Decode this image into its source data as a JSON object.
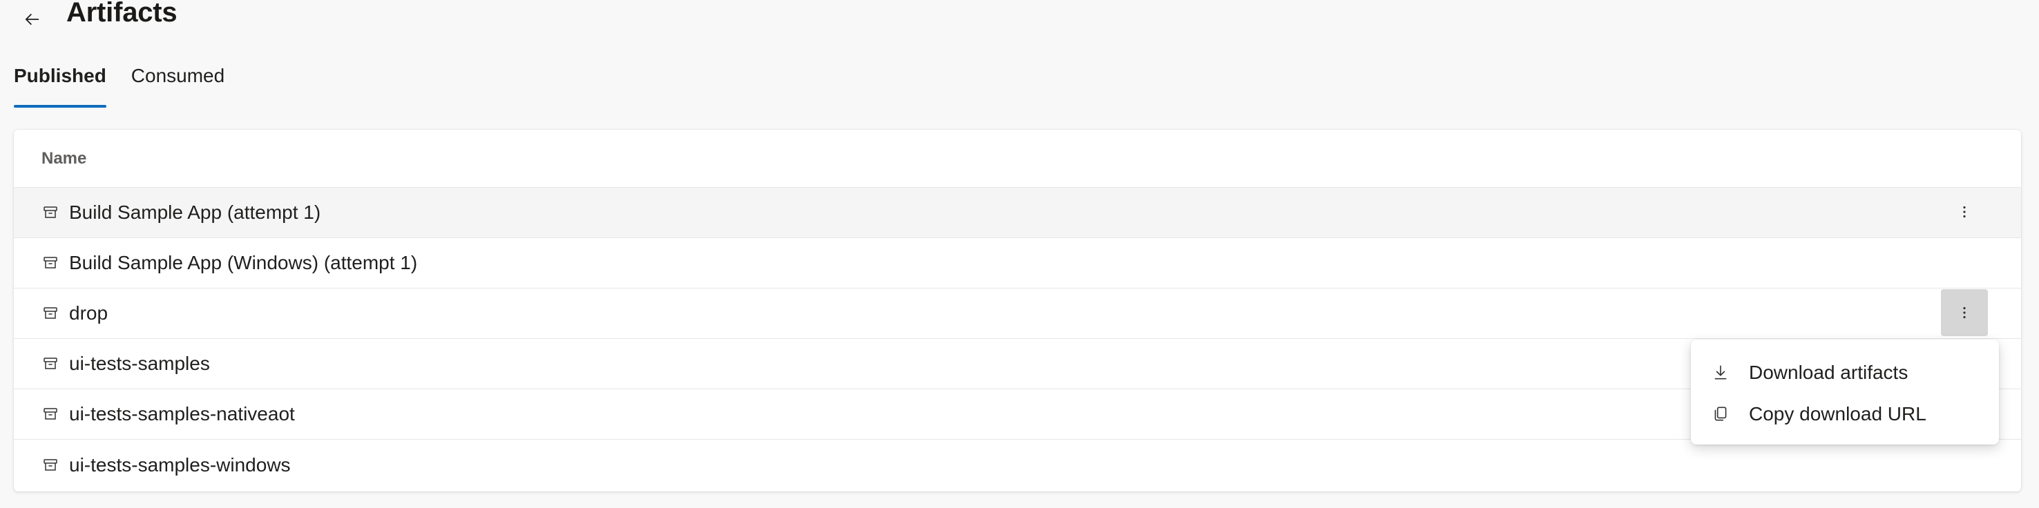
{
  "header": {
    "title": "Artifacts",
    "back_icon": "arrow-left-icon"
  },
  "tabs": [
    {
      "label": "Published",
      "active": true
    },
    {
      "label": "Consumed",
      "active": false
    }
  ],
  "table": {
    "column_header": "Name",
    "rows": [
      {
        "label": "Build Sample App (attempt 1)",
        "icon": "artifact-box-icon"
      },
      {
        "label": "Build Sample App (Windows) (attempt 1)",
        "icon": "artifact-box-icon"
      },
      {
        "label": "drop",
        "icon": "artifact-box-icon"
      },
      {
        "label": "ui-tests-samples",
        "icon": "artifact-box-icon"
      },
      {
        "label": "ui-tests-samples-nativeaot",
        "icon": "artifact-box-icon"
      },
      {
        "label": "ui-tests-samples-windows",
        "icon": "artifact-box-icon"
      }
    ]
  },
  "context_menu": {
    "items": [
      {
        "label": "Download artifacts",
        "icon": "download-icon"
      },
      {
        "label": "Copy download URL",
        "icon": "copy-icon"
      }
    ]
  },
  "colors": {
    "accent": "#0f6cbd",
    "background": "#f8f8f8",
    "card": "#ffffff",
    "pressed_button": "#d6d6d6"
  }
}
